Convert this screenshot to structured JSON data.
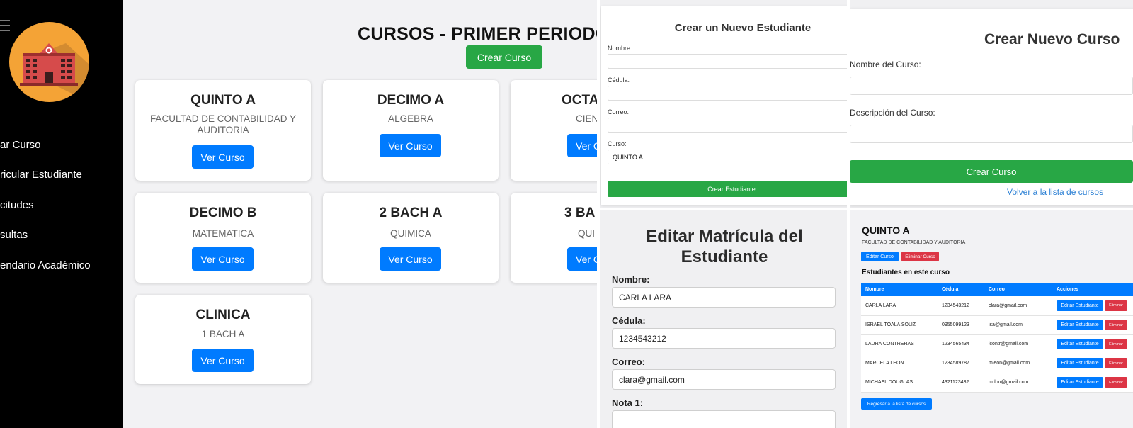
{
  "dashboard": {
    "title": "CURSOS - PRIMER PERIODO",
    "create_button": "Crear Curso",
    "sidebar": {
      "items": [
        "ar Curso",
        "ricular Estudiante",
        "citudes",
        "sultas",
        "endario Académico"
      ]
    },
    "courses": [
      {
        "name": "QUINTO A",
        "subject": "FACULTAD DE CONTABILIDAD Y AUDITORIA",
        "button": "Ver Curso"
      },
      {
        "name": "DECIMO A",
        "subject": "ALGEBRA",
        "button": "Ver Curso"
      },
      {
        "name": "OCTA",
        "subject": "CIEN",
        "button": "Ver C"
      },
      {
        "name": "DECIMO B",
        "subject": "MATEMATICA",
        "button": "Ver Curso"
      },
      {
        "name": "2 BACH A",
        "subject": "QUIMICA",
        "button": "Ver Curso"
      },
      {
        "name": "3 BA",
        "subject": "QUI",
        "button": "Ver C"
      },
      {
        "name": "CLINICA",
        "subject": "1 BACH A",
        "button": "Ver Curso"
      }
    ]
  },
  "new_student": {
    "title": "Crear un Nuevo Estudiante",
    "name_label": "Nombre:",
    "id_label": "Cédula:",
    "email_label": "Correo:",
    "course_label": "Curso:",
    "course_value": "QUINTO A",
    "submit": "Crear Estudiante"
  },
  "edit_enrollment": {
    "title": "Editar Matrícula del Estudiante",
    "name_label": "Nombre:",
    "name_value": "CARLA LARA",
    "id_label": "Cédula:",
    "id_value": "1234543212",
    "email_label": "Correo:",
    "email_value": "clara@gmail.com",
    "grade1_label": "Nota 1:"
  },
  "new_course": {
    "title": "Crear Nuevo Curso",
    "name_label": "Nombre del Curso:",
    "desc_label": "Descripción del Curso:",
    "submit": "Crear Curso",
    "back_link": "Volver a la lista de cursos"
  },
  "course_detail": {
    "title": "QUINTO A",
    "description": "FACULTAD DE CONTABILIDAD Y AUDITORIA",
    "edit_button": "Editar Curso",
    "delete_button": "Eliminar Curso",
    "students_heading": "Estudiantes en este curso",
    "columns": [
      "Nombre",
      "Cédula",
      "Correo",
      "Acciones"
    ],
    "row_edit_label": "Editar Estudiante",
    "row_delete_label": "Eliminar",
    "students": [
      {
        "name": "CARLA LARA",
        "id": "1234543212",
        "email": "clara@gmail.com"
      },
      {
        "name": "ISRAEL TOALA SOLIZ",
        "id": "0955099123",
        "email": "isa@gmail.com"
      },
      {
        "name": "LAURA CONTRERAS",
        "id": "1234565434",
        "email": "lcontr@gmail.com"
      },
      {
        "name": "MARCELA LEON",
        "id": "1234589787",
        "email": "mleon@gmail.com"
      },
      {
        "name": "MICHAEL DOUGLAS",
        "id": "4321123432",
        "email": "mdou@gmail.com"
      }
    ],
    "back_button": "Regresar a la lista de cursos"
  },
  "colors": {
    "primary": "#007bff",
    "success": "#28a745",
    "danger": "#dc3545",
    "sidebar": "#000000",
    "logo_bg": "#f4a336"
  }
}
